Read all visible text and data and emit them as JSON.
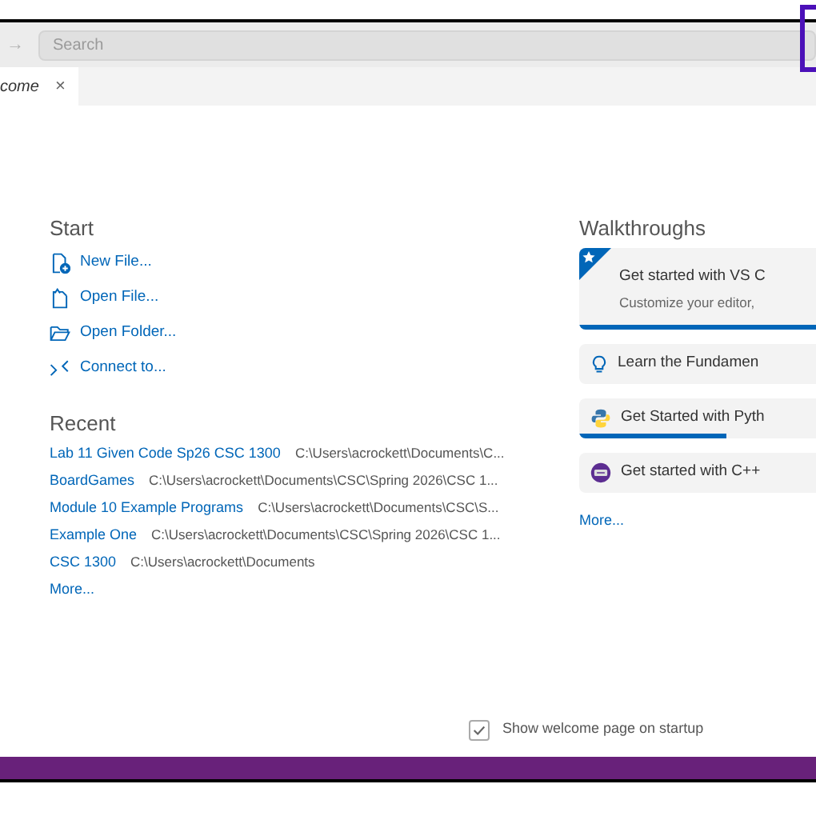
{
  "toolbar": {
    "nav_arrow": "→",
    "search": {
      "placeholder": "Search"
    }
  },
  "tabs": [
    {
      "label": "come",
      "close": "×",
      "selected": true
    }
  ],
  "start": {
    "title": "Start",
    "items": [
      {
        "kind": "new-file",
        "label": "New File..."
      },
      {
        "kind": "open-file",
        "label": "Open File..."
      },
      {
        "kind": "open-folder",
        "label": "Open Folder..."
      },
      {
        "kind": "connect",
        "label": "Connect to..."
      }
    ]
  },
  "recent": {
    "title": "Recent",
    "items": [
      {
        "name": "Lab 11 Given Code Sp26 CSC 1300",
        "path": "C:\\Users\\acrockett\\Documents\\C..."
      },
      {
        "name": "BoardGames",
        "path": "C:\\Users\\acrockett\\Documents\\CSC\\Spring 2026\\CSC 1..."
      },
      {
        "name": "Module 10 Example Programs",
        "path": "C:\\Users\\acrockett\\Documents\\CSC\\S..."
      },
      {
        "name": "Example One",
        "path": "C:\\Users\\acrockett\\Documents\\CSC\\Spring 2026\\CSC 1..."
      },
      {
        "name": "CSC 1300",
        "path": "C:\\Users\\acrockett\\Documents"
      }
    ],
    "more": "More..."
  },
  "walkthroughs": {
    "title": "Walkthroughs",
    "items": [
      {
        "kind": "featured",
        "title": "Get started with VS C",
        "subtitle": "Customize your editor,",
        "level": 1
      },
      {
        "kind": "bulb",
        "title": "Learn the Fundamen"
      },
      {
        "kind": "python",
        "title": "Get Started with Pyth",
        "level": 0.62
      },
      {
        "kind": "cpp",
        "title": "Get started with C++"
      }
    ],
    "more": "More..."
  },
  "footer": {
    "label": "Show welcome page on startup",
    "checked": true
  }
}
